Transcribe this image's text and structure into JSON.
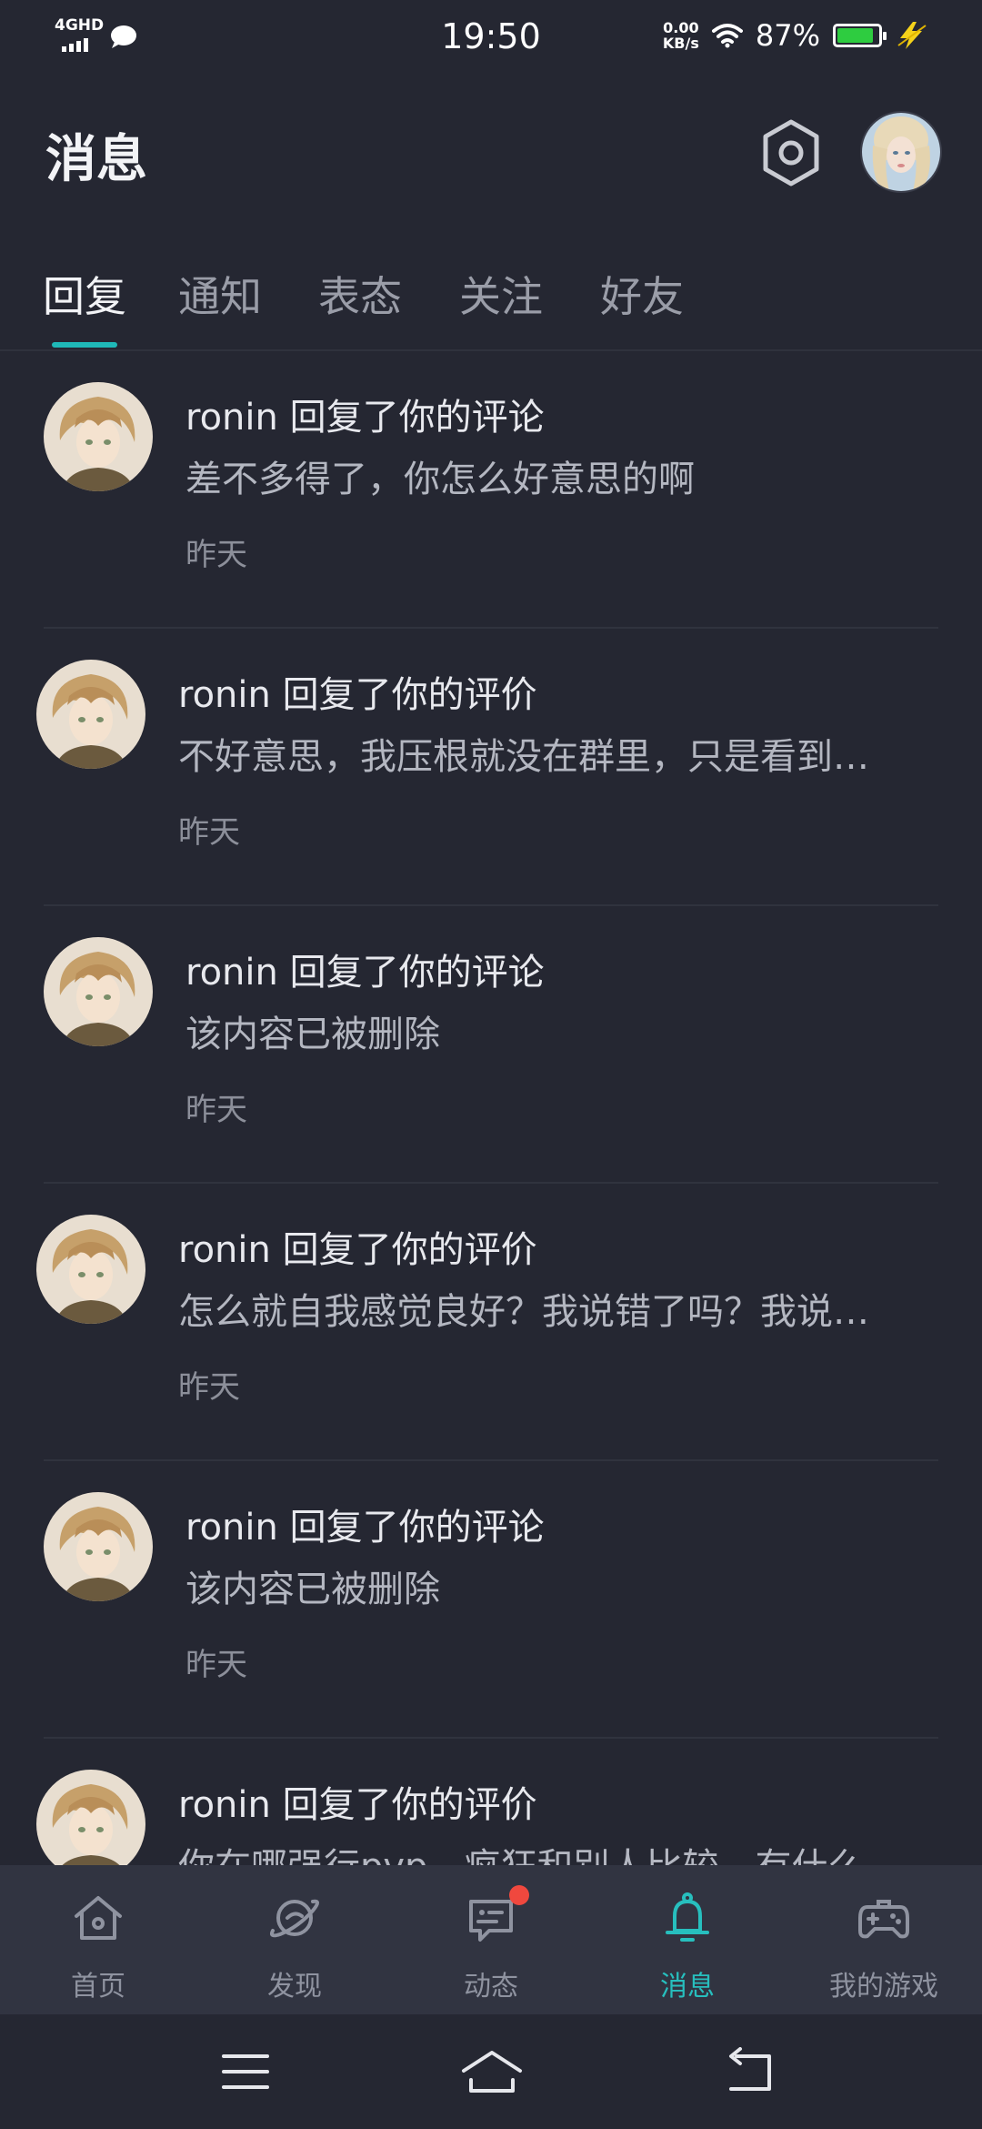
{
  "status_bar": {
    "network": "4GHD",
    "time": "19:50",
    "speed_value": "0.00",
    "speed_unit": "KB/s",
    "battery_percent": "87%"
  },
  "header": {
    "title": "消息"
  },
  "tabs": [
    {
      "label": "回复",
      "active": true
    },
    {
      "label": "通知",
      "active": false
    },
    {
      "label": "表态",
      "active": false
    },
    {
      "label": "关注",
      "active": false
    },
    {
      "label": "好友",
      "active": false
    }
  ],
  "messages": [
    {
      "title": "ronin 回复了你的评论",
      "body": "差不多得了，你怎么好意思的啊",
      "time": "昨天"
    },
    {
      "title": "ronin 回复了你的评价",
      "body": "不好意思，我压根就没在群里，只是看到…",
      "time": "昨天"
    },
    {
      "title": "ronin 回复了你的评论",
      "body": "该内容已被删除",
      "time": "昨天"
    },
    {
      "title": "ronin 回复了你的评价",
      "body": "怎么就自我感觉良好？我说错了吗？我说…",
      "time": "昨天"
    },
    {
      "title": "ronin 回复了你的评论",
      "body": "该内容已被删除",
      "time": "昨天"
    },
    {
      "title": "ronin 回复了你的评价",
      "body": "你在哪强行pvp，疯狂和别人比较，有什么…",
      "time": ""
    }
  ],
  "bottom_nav": [
    {
      "label": "首页",
      "icon": "home-icon",
      "active": false
    },
    {
      "label": "发现",
      "icon": "planet-icon",
      "active": false
    },
    {
      "label": "动态",
      "icon": "chat-bubble-icon",
      "active": false,
      "badge": true
    },
    {
      "label": "消息",
      "icon": "bell-icon",
      "active": true
    },
    {
      "label": "我的游戏",
      "icon": "gamepad-icon",
      "active": false
    }
  ],
  "colors": {
    "background": "#252732",
    "accent": "#1FB9B8",
    "badge": "#F0483E",
    "nav_background": "#313441"
  }
}
